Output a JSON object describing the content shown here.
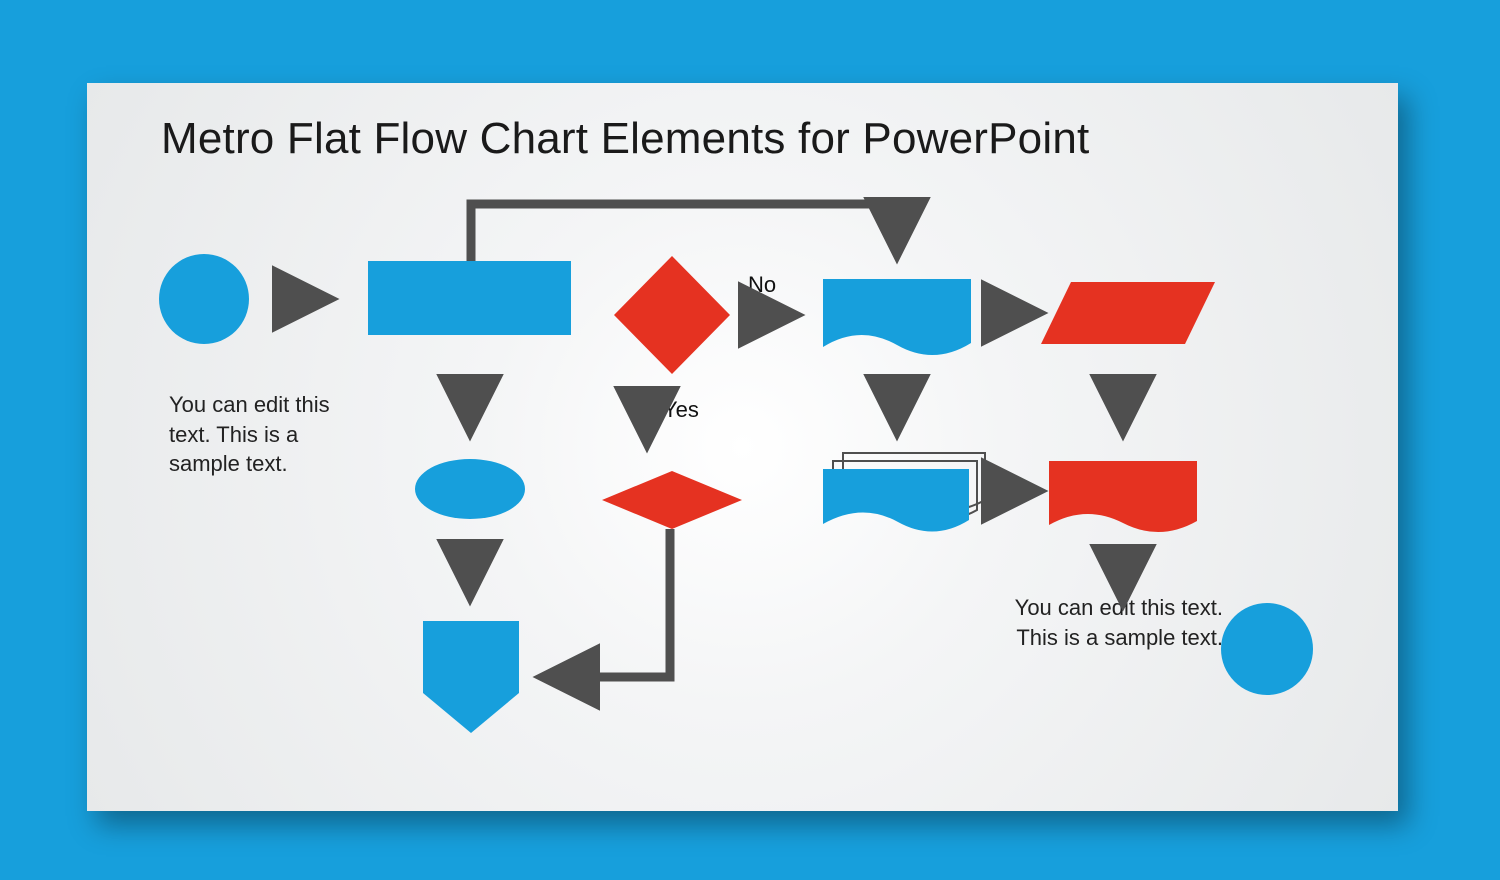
{
  "title": "Metro Flat Flow Chart Elements for PowerPoint",
  "labels": {
    "decision_no": "No",
    "decision_yes": "Yes"
  },
  "captions": {
    "left": "You can edit this text. This is a sample text.",
    "right": "You can edit this text. This is a sample text."
  },
  "colors": {
    "blue": "#179fdc",
    "red": "#e53221",
    "arrow": "#4f4f4f"
  },
  "shapes": [
    {
      "id": "start-circle",
      "type": "circle",
      "fill": "blue"
    },
    {
      "id": "process-rect",
      "type": "rectangle",
      "fill": "blue"
    },
    {
      "id": "decision-diamond",
      "type": "diamond",
      "fill": "red"
    },
    {
      "id": "document-wave",
      "type": "document",
      "fill": "blue"
    },
    {
      "id": "data-parallelogram",
      "type": "parallelogram",
      "fill": "red"
    },
    {
      "id": "ellipse-small",
      "type": "ellipse",
      "fill": "blue"
    },
    {
      "id": "decision-flat",
      "type": "flat-diamond",
      "fill": "red"
    },
    {
      "id": "multi-document",
      "type": "multi-document",
      "fill": "blue"
    },
    {
      "id": "display-shape",
      "type": "display",
      "fill": "red"
    },
    {
      "id": "offpage-pentagon",
      "type": "pentagon-down",
      "fill": "blue"
    },
    {
      "id": "end-circle",
      "type": "circle",
      "fill": "blue"
    }
  ]
}
